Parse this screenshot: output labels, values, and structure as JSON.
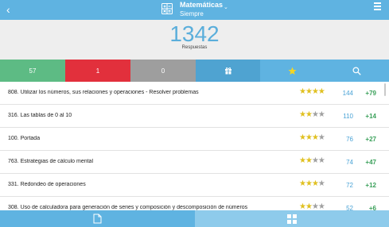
{
  "header": {
    "back_glyph": "‹",
    "title": "Matemáticas",
    "subtitle": "Siempre",
    "caret": "⌄",
    "icons": [
      "chevron-left-icon",
      "calculator-icon",
      "hamburger-menu-icon"
    ]
  },
  "summary": {
    "total": "1342",
    "label": "Respuestas"
  },
  "filters": [
    {
      "label": "57",
      "color": "#5dbb84"
    },
    {
      "label": "1",
      "color": "#e2303c"
    },
    {
      "label": "0",
      "color": "#9e9e9e"
    },
    {
      "icon": "gift-icon",
      "color": "#4fa3d1"
    },
    {
      "icon": "star-icon",
      "color": "#5fb3e1"
    },
    {
      "icon": "search-icon",
      "color": "#5fb3e1"
    }
  ],
  "rows": [
    {
      "title": "808. Utilizar los números, sus relaciones y operaciones - Resolver problemas",
      "stars": 4,
      "count": "144",
      "gain": "+79"
    },
    {
      "title": "316. Las tablas de 0 al 10",
      "stars": 2,
      "count": "110",
      "gain": "+14"
    },
    {
      "title": "100. Portada",
      "stars": 3,
      "count": "76",
      "gain": "+27"
    },
    {
      "title": "763. Estrategias de cálculo mental",
      "stars": 2,
      "count": "74",
      "gain": "+47"
    },
    {
      "title": "331. Redondeo de operaciones",
      "stars": 3,
      "count": "72",
      "gain": "+12"
    },
    {
      "title": "308. Uso de calculadora para generación de series y composición y descomposición de números",
      "stars": 2,
      "count": "52",
      "gain": "+6"
    }
  ],
  "stars_max": 4,
  "bottom_tabs": [
    {
      "icon": "document-icon",
      "active": true
    },
    {
      "icon": "grid-icon",
      "active": false
    }
  ],
  "colors": {
    "primary": "#5fb3e1",
    "star_on": "#e0c020",
    "star_off": "#a0a0a0",
    "count": "#4aa3d6",
    "gain": "#3aa05a"
  }
}
